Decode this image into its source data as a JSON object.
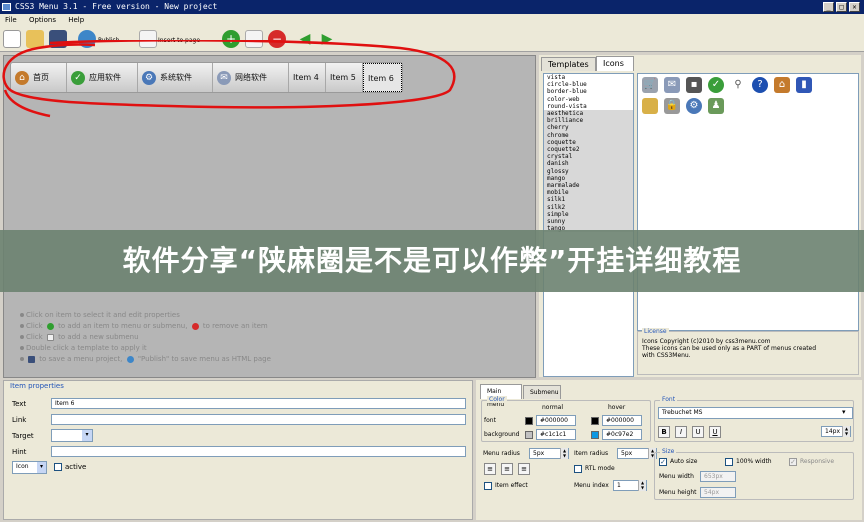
{
  "window": {
    "title": "CSS3 Menu 3.1 - Free version - New project",
    "min": "_",
    "max": "□",
    "close": "✕"
  },
  "menubar": [
    "File",
    "Options",
    "Help"
  ],
  "toolbar": {
    "publish": "Publish",
    "insert": "Insert to page"
  },
  "menu_items": [
    "首页",
    "应用软件",
    "系统软件",
    "网络软件",
    "Item 4",
    "Item 5",
    "Item 6"
  ],
  "hints": [
    "Click on item to select it and edit properties",
    "Click",
    "to add an item to menu or submenu,",
    "to remove an item",
    "Click",
    "to add a new submenu",
    "Double click a template to apply it",
    "to save a menu project,",
    "\"Publish\" to save menu as HTML page"
  ],
  "banner": "软件分享“陕麻圈是不是可以作弊”开挂详细教程",
  "right_tabs": [
    "Templates",
    "Icons"
  ],
  "templates": [
    "vista",
    "circle-blue",
    "border-blue",
    "color-web",
    "round-vista",
    "aesthetica",
    "brilliance",
    "cherry",
    "chrome",
    "coquette",
    "coquette2",
    "crystal",
    "danish",
    "glossy",
    "mango",
    "marmalade",
    "mobile",
    "silk1",
    "silk2",
    "simple",
    "sunny",
    "tango"
  ],
  "license": {
    "legend": "License",
    "line1": "Icons Copyright (c)2010 by css3menu.com",
    "line2": "These icons can be used only as a PART of menus created",
    "line3": "with CSS3Menu."
  },
  "item_props": {
    "legend": "Item properties",
    "text_label": "Text",
    "text_value": "Item 6",
    "link_label": "Link",
    "target_label": "Target",
    "hint_label": "Hint",
    "icon_select": "Icon",
    "active_label": "active"
  },
  "bottom_tabs": [
    "Main menu",
    "Submenu"
  ],
  "color": {
    "legend": "Color",
    "normal": "normal",
    "hover": "hover",
    "font_label": "font",
    "font_normal": "#000000",
    "font_hover": "#000000",
    "bg_label": "background",
    "bg_normal": "#c1c1c1",
    "bg_hover": "#0c97e2",
    "c_font": "#000000",
    "c_bg_normal": "#c1c1c1",
    "c_bg_hover": "#0c97e2"
  },
  "radius": {
    "menu_label": "Menu radius",
    "menu_value": "5px",
    "item_label": "Item radius",
    "item_value": "5px"
  },
  "rtl": "RTL mode",
  "effect": "Item effect",
  "index": {
    "label": "Menu index",
    "value": "1"
  },
  "font": {
    "legend": "Font",
    "family": "Trebuchet MS",
    "b": "B",
    "i": "I",
    "u": "U",
    "underline": "U",
    "size": "14px"
  },
  "size": {
    "legend": "Size",
    "auto": "Auto size",
    "full": "100% width",
    "responsive": "Responsive",
    "w_label": "Menu width",
    "w_value": "653px",
    "h_label": "Menu height",
    "h_value": "54px"
  }
}
